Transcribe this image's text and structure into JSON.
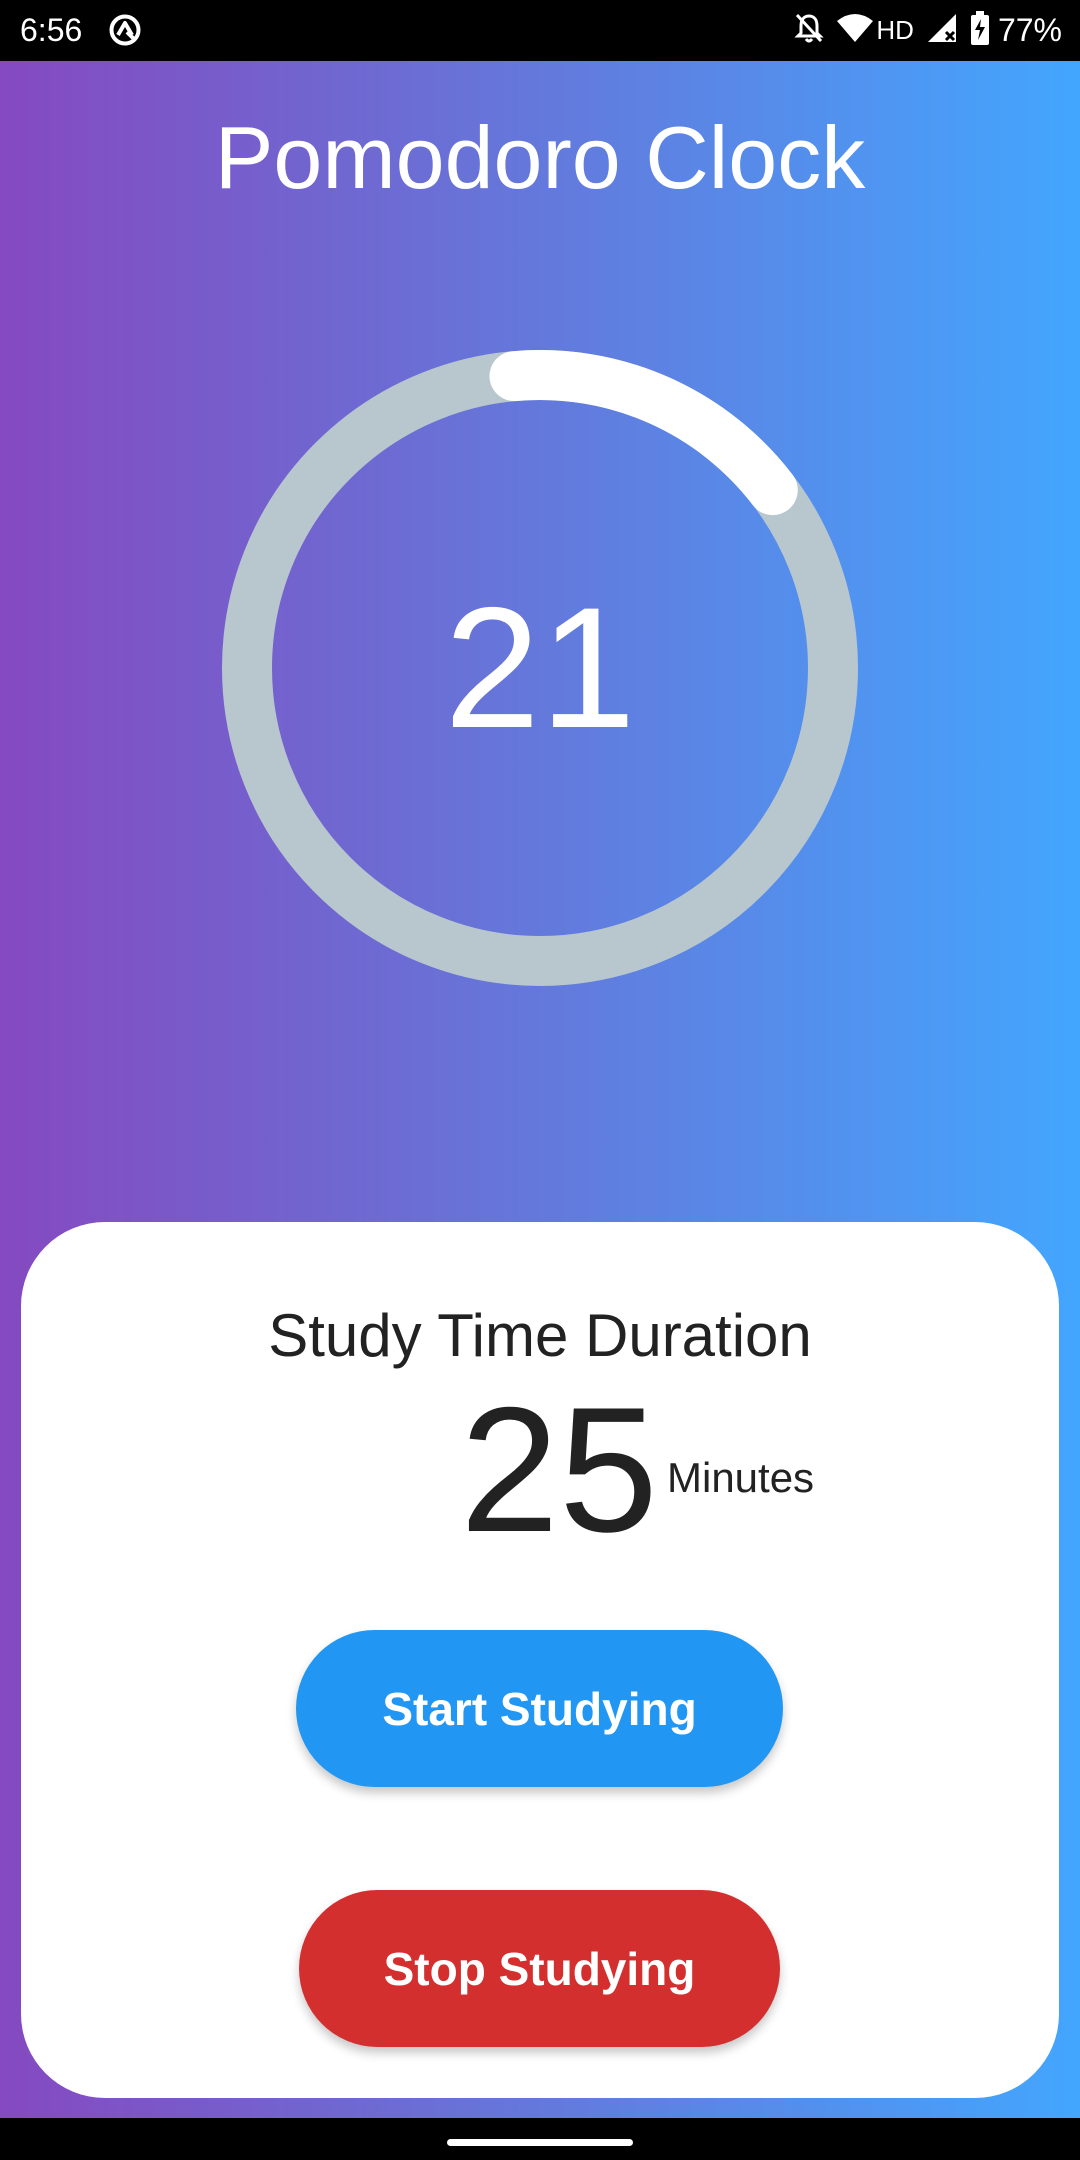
{
  "status_bar": {
    "time": "6:56",
    "network": "HD",
    "battery": "77%",
    "icons": [
      "app-notification-icon",
      "notifications-off-icon",
      "wifi-icon",
      "cell-signal-icon",
      "battery-charging-icon"
    ]
  },
  "app": {
    "title": "Pomodoro Clock"
  },
  "timer": {
    "value": "21",
    "progress_fraction": 0.16,
    "ring_track_color": "#B8C7CE",
    "ring_progress_color": "#FFFFFF"
  },
  "card": {
    "title": "Study Time Duration",
    "duration_value": "25",
    "duration_unit": "Minutes",
    "start_label": "Start Studying",
    "stop_label": "Stop Studying"
  },
  "colors": {
    "gradient_start": "#8549C0",
    "gradient_end": "#43A6FE",
    "start_button": "#2196F3",
    "stop_button": "#D32F2F"
  }
}
